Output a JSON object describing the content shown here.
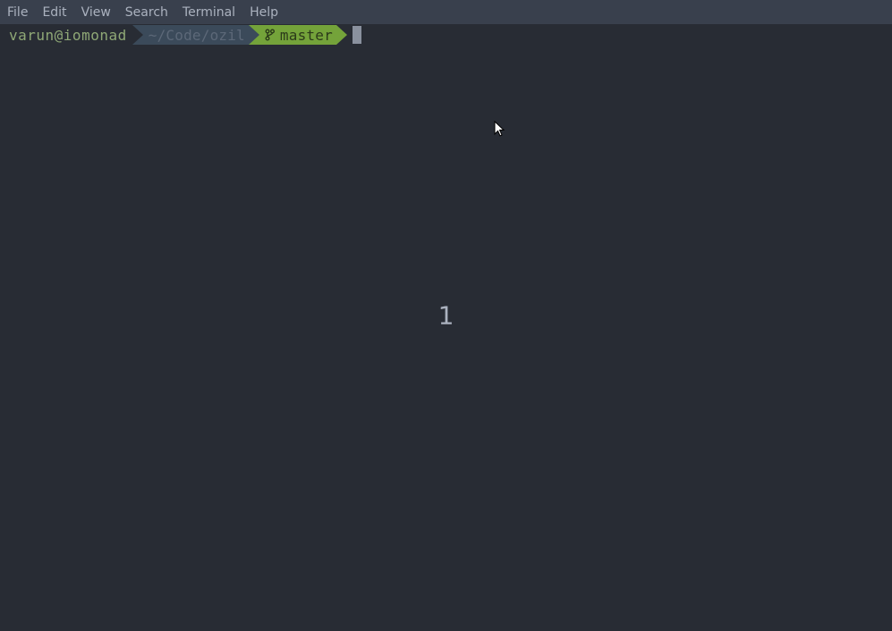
{
  "menubar": {
    "items": [
      "File",
      "Edit",
      "View",
      "Search",
      "Terminal",
      "Help"
    ]
  },
  "prompt": {
    "user_host": "varun@iomonad",
    "path": "~/Code/ozil",
    "branch": "master"
  },
  "content": {
    "center_text": "1"
  }
}
